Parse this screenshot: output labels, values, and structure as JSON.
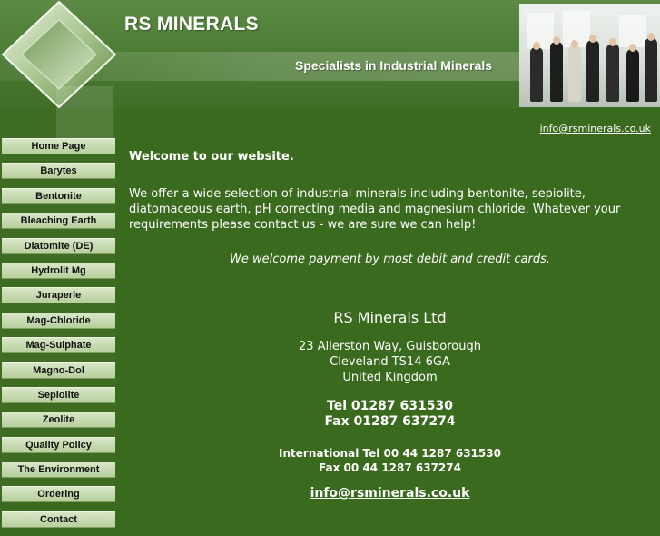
{
  "header": {
    "brand": "RS MINERALS",
    "tagline": "Specialists in Industrial Minerals"
  },
  "nav": {
    "items": [
      "Home Page",
      "Barytes",
      "Bentonite",
      "Bleaching Earth",
      "Diatomite (DE)",
      "Hydrolit Mg",
      "Juraperle",
      "Mag-Chloride",
      "Mag-Sulphate",
      "Magno-Dol",
      "Sepiolite",
      "Zeolite",
      "Quality Policy",
      "The Environment",
      "Ordering",
      "Contact"
    ]
  },
  "main": {
    "email_top": "info@rsminerals.co.uk",
    "welcome": "Welcome to our website.",
    "intro": "We offer a wide selection of industrial minerals including bentonite, sepiolite, diatomaceous earth, pH correcting media and magnesium chloride.  Whatever your requirements please contact us - we are sure we can help!",
    "payment": "We welcome payment by most debit and credit cards.",
    "company": "RS Minerals Ltd",
    "street": "23 Allerston Way, Guisborough",
    "town": "Cleveland TS14 6GA",
    "country": "United Kingdom",
    "tel": "Tel 01287 631530",
    "fax": "Fax 01287 637274",
    "intl_tel": "International Tel 00 44 1287 631530",
    "intl_fax": "Fax 00 44 1287 637274",
    "email_bottom": "info@rsminerals.co.uk"
  },
  "colors": {
    "background": "#3a6a1e",
    "nav_button": "#c8dcb0",
    "text": "#ffffff"
  }
}
